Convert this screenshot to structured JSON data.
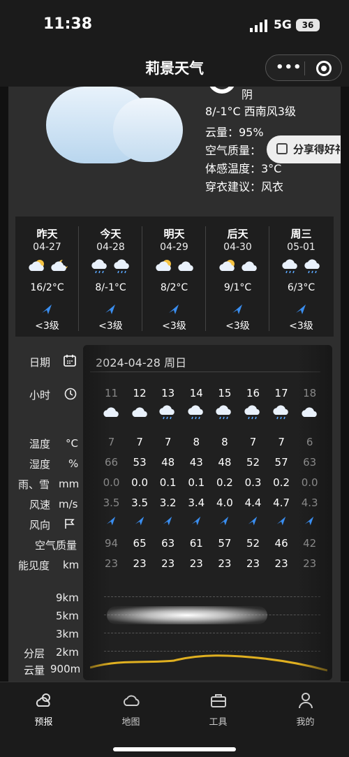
{
  "status_bar": {
    "time": "11:38",
    "network": "5G",
    "battery": "36"
  },
  "navbar": {
    "title": "莉景天气",
    "more": "•••"
  },
  "current": {
    "condition": "阴",
    "temp_wind": "8/-1°C  西南风3级",
    "cloud": "云量：95%",
    "air": "空气质量：",
    "feels": "体感温度：3°C",
    "dress": "穿衣建议：风衣",
    "share_label": "分享得好礼"
  },
  "forecast": [
    {
      "name": "昨天",
      "date": "04-27",
      "temp": "16/2°C",
      "wind": "<3级",
      "icons": [
        "sun-cloud-icon",
        "moon-cloud-icon"
      ]
    },
    {
      "name": "今天",
      "date": "04-28",
      "temp": "8/-1°C",
      "wind": "<3级",
      "icons": [
        "rain-cloud-icon",
        "rain-cloud-icon"
      ]
    },
    {
      "name": "明天",
      "date": "04-29",
      "temp": "8/2°C",
      "wind": "<3级",
      "icons": [
        "sun-cloud-icon",
        "cloud-icon"
      ]
    },
    {
      "name": "后天",
      "date": "04-30",
      "temp": "9/1°C",
      "wind": "<3级",
      "icons": [
        "sun-cloud-icon",
        "cloud-icon"
      ]
    },
    {
      "name": "周三",
      "date": "05-01",
      "temp": "6/3°C",
      "wind": "<3级",
      "icons": [
        "rain-cloud-icon",
        "rain-cloud-icon"
      ]
    }
  ],
  "hourly": {
    "labels": {
      "date": "日期",
      "hour": "小时",
      "temp": "温度",
      "temp_unit": "°C",
      "humidity": "湿度",
      "humidity_unit": "%",
      "precip": "雨、雪",
      "precip_unit": "mm",
      "wind_speed": "风速",
      "wind_speed_unit": "m/s",
      "wind_dir": "风向",
      "aqi": "空气质量",
      "visibility": "能见度",
      "visibility_unit": "km",
      "layer": "分层",
      "cloud": "云量"
    },
    "date_text": "2024-04-28 周日",
    "columns": [
      {
        "hour": "11",
        "temp": "7",
        "humidity": "66",
        "precip": "0.0",
        "wind": "3.5",
        "aqi": "94",
        "vis": "23",
        "icon": "cloud-icon"
      },
      {
        "hour": "12",
        "temp": "7",
        "humidity": "53",
        "precip": "0.0",
        "wind": "3.5",
        "aqi": "65",
        "vis": "23",
        "icon": "cloud-icon"
      },
      {
        "hour": "13",
        "temp": "7",
        "humidity": "48",
        "precip": "0.1",
        "wind": "3.2",
        "aqi": "63",
        "vis": "23",
        "icon": "rain-cloud-icon"
      },
      {
        "hour": "14",
        "temp": "8",
        "humidity": "43",
        "precip": "0.1",
        "wind": "3.4",
        "aqi": "61",
        "vis": "23",
        "icon": "rain-cloud-icon"
      },
      {
        "hour": "15",
        "temp": "8",
        "humidity": "48",
        "precip": "0.2",
        "wind": "4.0",
        "aqi": "57",
        "vis": "23",
        "icon": "rain-cloud-icon"
      },
      {
        "hour": "16",
        "temp": "7",
        "humidity": "52",
        "precip": "0.3",
        "wind": "4.4",
        "aqi": "52",
        "vis": "23",
        "icon": "rain-cloud-icon"
      },
      {
        "hour": "17",
        "temp": "7",
        "humidity": "57",
        "precip": "0.2",
        "wind": "4.7",
        "aqi": "46",
        "vis": "23",
        "icon": "rain-cloud-icon"
      },
      {
        "hour": "18",
        "temp": "6",
        "humidity": "63",
        "precip": "0.0",
        "wind": "4.3",
        "aqi": "42",
        "vis": "23",
        "icon": "cloud-icon"
      }
    ],
    "layer_heights": [
      "9km",
      "5km",
      "3km",
      "2km",
      "900m"
    ]
  },
  "tabbar": [
    {
      "label": "预报",
      "icon": "weather-icon"
    },
    {
      "label": "地图",
      "icon": "map-cloud-icon"
    },
    {
      "label": "工具",
      "icon": "toolbox-icon"
    },
    {
      "label": "我的",
      "icon": "user-icon"
    }
  ]
}
